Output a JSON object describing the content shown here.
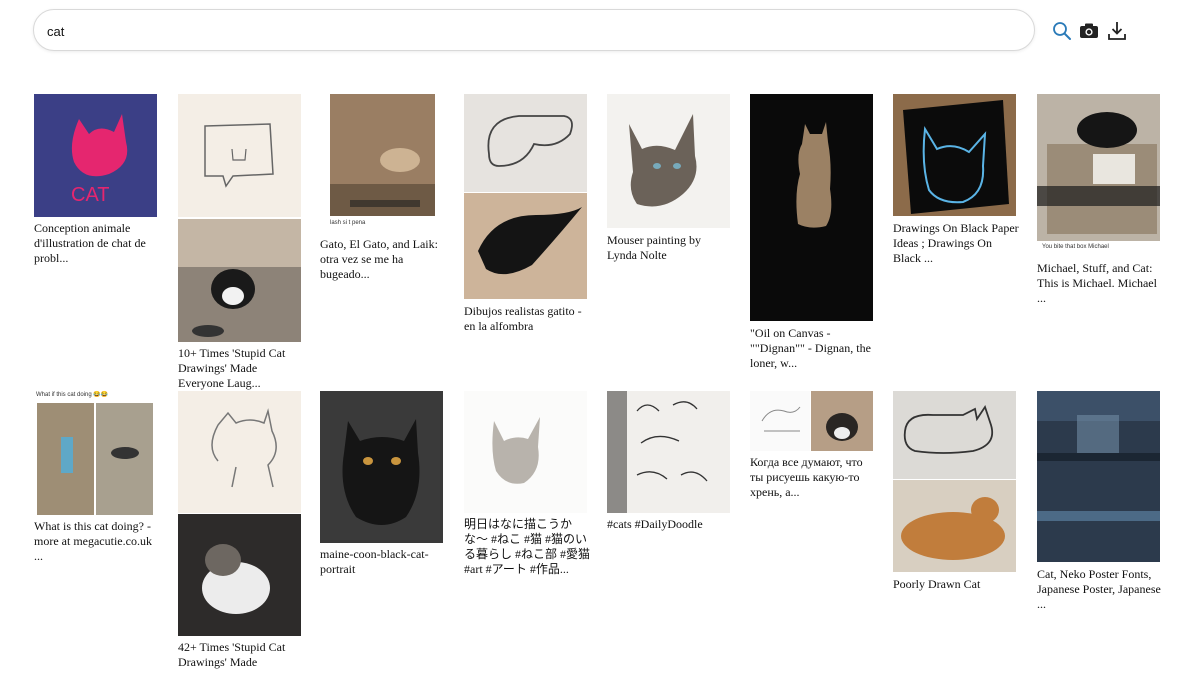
{
  "search": {
    "query": "cat"
  },
  "toolbar": {
    "search_icon": "search-icon",
    "camera_icon": "camera-icon",
    "download_icon": "download-icon"
  },
  "results": [
    {
      "caption": "Conception animale d'illustration de chat de probl..."
    },
    {
      "caption": "10+ Times 'Stupid Cat Drawings' Made Everyone Laug..."
    },
    {
      "caption": "Gato, El Gato, and Laik: otra vez se me ha bugeado...",
      "overlay": "lash si t pena"
    },
    {
      "caption": "Dibujos realistas gatito - en la alfombra"
    },
    {
      "caption": "Mouser painting by Lynda Nolte"
    },
    {
      "caption": "\"Oil on Canvas - \"\"Dignan\"\" - Dignan, the loner, w..."
    },
    {
      "caption": "Drawings On Black Paper Ideas ; Drawings On Black ..."
    },
    {
      "caption": "Michael, Stuff, and Cat: This is Michael. Michael ...",
      "overlay": "You bite that box Michael"
    },
    {
      "caption": "What is this cat doing? - more at megacutie.co.uk ...",
      "overlay": "What if this cat doing 😂😂"
    },
    {
      "caption": "42+ Times 'Stupid Cat Drawings' Made"
    },
    {
      "caption": "maine-coon-black-cat-portrait"
    },
    {
      "caption": "明日はなに描こうかな〜 #ねこ #猫 #猫のいる暮らし #ねこ部 #愛猫 #art #アート #作品..."
    },
    {
      "caption": "#cats #DailyDoodle"
    },
    {
      "caption": "Когда все думают, что ты рисуешь какую-то хрень, а..."
    },
    {
      "caption": "Poorly Drawn Cat"
    },
    {
      "caption": "Cat, Neko Poster Fonts, Japanese Poster, Japanese ..."
    }
  ],
  "colors": {
    "accent": "#2a7ab8",
    "search_border": "#d9d9d9"
  }
}
